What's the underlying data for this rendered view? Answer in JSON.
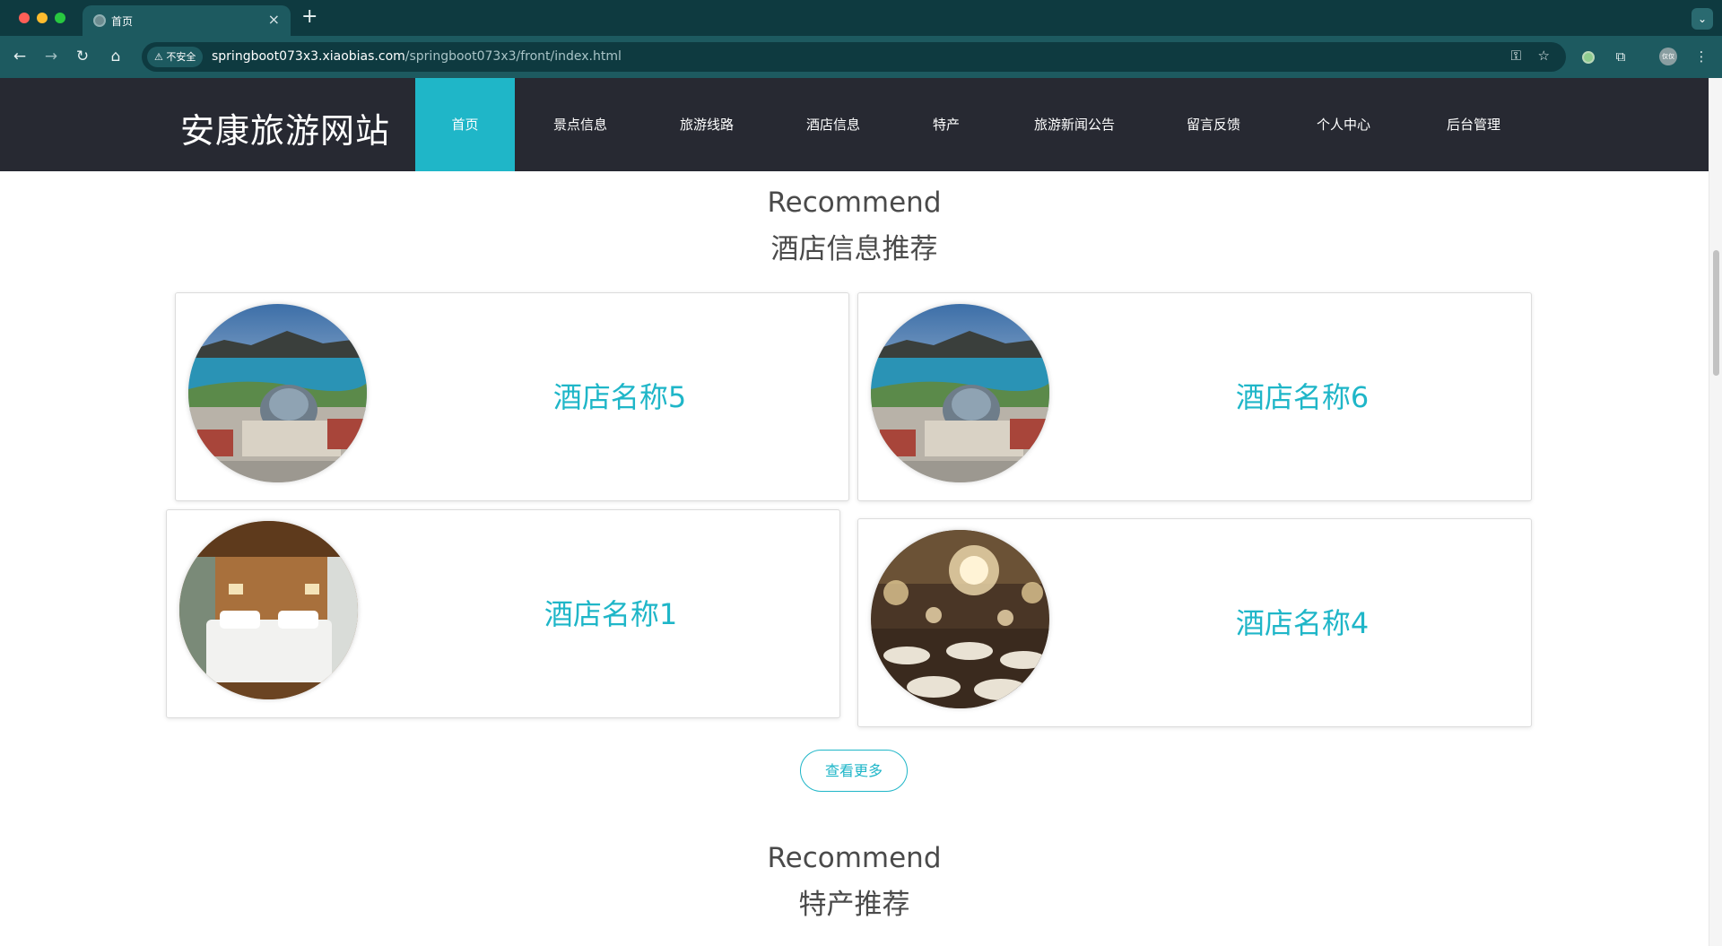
{
  "browser": {
    "tab_title": "首页",
    "tab_close": "×",
    "new_tab": "+",
    "menu": "⌄",
    "security_label": "⚠ 不安全",
    "url_host": "springboot073x3.xiaobias.com",
    "url_path": "/springboot073x3/front/index.html",
    "profile_label": "仅仅"
  },
  "site": {
    "logo": "安康旅游网站",
    "nav": [
      {
        "label": "首页",
        "active": true
      },
      {
        "label": "景点信息"
      },
      {
        "label": "旅游线路"
      },
      {
        "label": "酒店信息"
      },
      {
        "label": "特产"
      },
      {
        "label": "旅游新闻公告"
      },
      {
        "label": "留言反馈"
      },
      {
        "label": "个人中心"
      },
      {
        "label": "后台管理"
      }
    ]
  },
  "hotel_section": {
    "title_en": "Recommend",
    "title_cn": "酒店信息推荐",
    "cards": [
      {
        "name": "酒店名称5",
        "image": "lakeside-dome-building"
      },
      {
        "name": "酒店名称6",
        "image": "lakeside-dome-building"
      },
      {
        "name": "酒店名称1",
        "image": "wooden-hotel-bedroom"
      },
      {
        "name": "酒店名称4",
        "image": "chandelier-banquet-hall"
      }
    ],
    "more_button": "查看更多"
  },
  "specialty_section": {
    "title_en": "Recommend",
    "title_cn": "特产推荐"
  },
  "colors": {
    "accent": "#1fb6c8",
    "header_bg": "#272932",
    "chrome_dark": "#0e3a40",
    "chrome_mid": "#1d5a60"
  }
}
